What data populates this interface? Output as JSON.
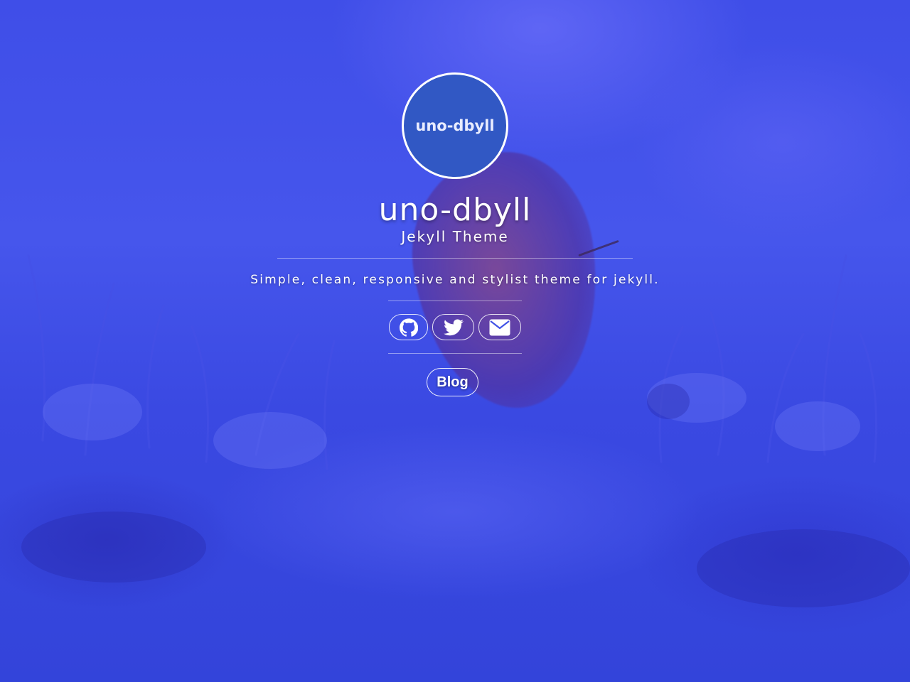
{
  "logo": {
    "text": "uno-dbyll"
  },
  "header": {
    "title": "uno-dbyll",
    "subtitle": "Jekyll Theme",
    "tagline": "Simple, clean, responsive and stylist theme for jekyll."
  },
  "social": {
    "links": [
      {
        "icon": "github-icon"
      },
      {
        "icon": "twitter-icon"
      },
      {
        "icon": "envelope-icon"
      }
    ]
  },
  "nav": {
    "blog_label": "Blog"
  },
  "colors": {
    "background": "#3f4ee8",
    "logo_fill": "#3158c4",
    "text": "#ffffff"
  }
}
